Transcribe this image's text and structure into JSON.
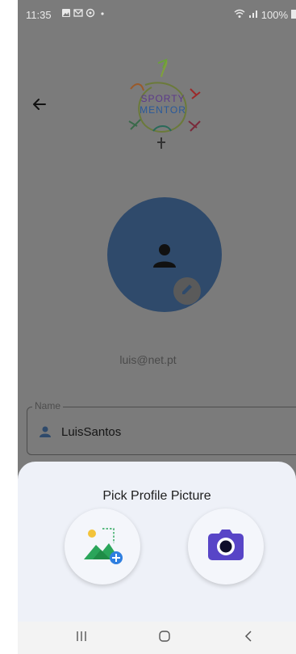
{
  "status_bar": {
    "time": "11:35",
    "battery": "100%"
  },
  "logo": {
    "line1": "SPORTY",
    "line2": "MENTOR"
  },
  "profile": {
    "email": "luis@net.pt"
  },
  "name_field": {
    "label": "Name",
    "value": "LuisSantos"
  },
  "bottom_sheet": {
    "title": "Pick Profile Picture"
  },
  "colors": {
    "avatar": "#2f4a6b",
    "camera_accent": "#5845c7",
    "gallery_green": "#2aa55a",
    "gallery_badge": "#2f7fe0"
  },
  "icons": [
    "back-arrow-icon",
    "person-icon",
    "edit-icon",
    "gallery-add-icon",
    "camera-icon",
    "recents-icon",
    "home-icon",
    "nav-back-icon"
  ]
}
